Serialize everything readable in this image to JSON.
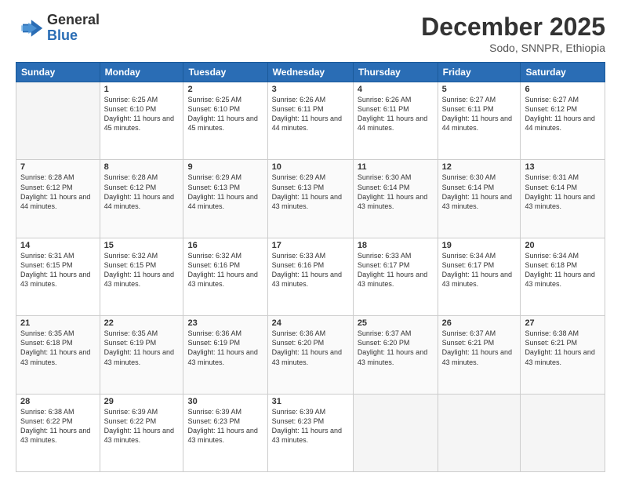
{
  "logo": {
    "general": "General",
    "blue": "Blue"
  },
  "header": {
    "title": "December 2025",
    "subtitle": "Sodo, SNNPR, Ethiopia"
  },
  "days_of_week": [
    "Sunday",
    "Monday",
    "Tuesday",
    "Wednesday",
    "Thursday",
    "Friday",
    "Saturday"
  ],
  "weeks": [
    [
      {
        "day": "",
        "empty": true
      },
      {
        "day": "1",
        "sunrise": "6:25 AM",
        "sunset": "6:10 PM",
        "daylight": "11 hours and 45 minutes."
      },
      {
        "day": "2",
        "sunrise": "6:25 AM",
        "sunset": "6:10 PM",
        "daylight": "11 hours and 45 minutes."
      },
      {
        "day": "3",
        "sunrise": "6:26 AM",
        "sunset": "6:11 PM",
        "daylight": "11 hours and 44 minutes."
      },
      {
        "day": "4",
        "sunrise": "6:26 AM",
        "sunset": "6:11 PM",
        "daylight": "11 hours and 44 minutes."
      },
      {
        "day": "5",
        "sunrise": "6:27 AM",
        "sunset": "6:11 PM",
        "daylight": "11 hours and 44 minutes."
      },
      {
        "day": "6",
        "sunrise": "6:27 AM",
        "sunset": "6:12 PM",
        "daylight": "11 hours and 44 minutes."
      }
    ],
    [
      {
        "day": "7",
        "sunrise": "6:28 AM",
        "sunset": "6:12 PM",
        "daylight": "11 hours and 44 minutes."
      },
      {
        "day": "8",
        "sunrise": "6:28 AM",
        "sunset": "6:12 PM",
        "daylight": "11 hours and 44 minutes."
      },
      {
        "day": "9",
        "sunrise": "6:29 AM",
        "sunset": "6:13 PM",
        "daylight": "11 hours and 44 minutes."
      },
      {
        "day": "10",
        "sunrise": "6:29 AM",
        "sunset": "6:13 PM",
        "daylight": "11 hours and 43 minutes."
      },
      {
        "day": "11",
        "sunrise": "6:30 AM",
        "sunset": "6:14 PM",
        "daylight": "11 hours and 43 minutes."
      },
      {
        "day": "12",
        "sunrise": "6:30 AM",
        "sunset": "6:14 PM",
        "daylight": "11 hours and 43 minutes."
      },
      {
        "day": "13",
        "sunrise": "6:31 AM",
        "sunset": "6:14 PM",
        "daylight": "11 hours and 43 minutes."
      }
    ],
    [
      {
        "day": "14",
        "sunrise": "6:31 AM",
        "sunset": "6:15 PM",
        "daylight": "11 hours and 43 minutes."
      },
      {
        "day": "15",
        "sunrise": "6:32 AM",
        "sunset": "6:15 PM",
        "daylight": "11 hours and 43 minutes."
      },
      {
        "day": "16",
        "sunrise": "6:32 AM",
        "sunset": "6:16 PM",
        "daylight": "11 hours and 43 minutes."
      },
      {
        "day": "17",
        "sunrise": "6:33 AM",
        "sunset": "6:16 PM",
        "daylight": "11 hours and 43 minutes."
      },
      {
        "day": "18",
        "sunrise": "6:33 AM",
        "sunset": "6:17 PM",
        "daylight": "11 hours and 43 minutes."
      },
      {
        "day": "19",
        "sunrise": "6:34 AM",
        "sunset": "6:17 PM",
        "daylight": "11 hours and 43 minutes."
      },
      {
        "day": "20",
        "sunrise": "6:34 AM",
        "sunset": "6:18 PM",
        "daylight": "11 hours and 43 minutes."
      }
    ],
    [
      {
        "day": "21",
        "sunrise": "6:35 AM",
        "sunset": "6:18 PM",
        "daylight": "11 hours and 43 minutes."
      },
      {
        "day": "22",
        "sunrise": "6:35 AM",
        "sunset": "6:19 PM",
        "daylight": "11 hours and 43 minutes."
      },
      {
        "day": "23",
        "sunrise": "6:36 AM",
        "sunset": "6:19 PM",
        "daylight": "11 hours and 43 minutes."
      },
      {
        "day": "24",
        "sunrise": "6:36 AM",
        "sunset": "6:20 PM",
        "daylight": "11 hours and 43 minutes."
      },
      {
        "day": "25",
        "sunrise": "6:37 AM",
        "sunset": "6:20 PM",
        "daylight": "11 hours and 43 minutes."
      },
      {
        "day": "26",
        "sunrise": "6:37 AM",
        "sunset": "6:21 PM",
        "daylight": "11 hours and 43 minutes."
      },
      {
        "day": "27",
        "sunrise": "6:38 AM",
        "sunset": "6:21 PM",
        "daylight": "11 hours and 43 minutes."
      }
    ],
    [
      {
        "day": "28",
        "sunrise": "6:38 AM",
        "sunset": "6:22 PM",
        "daylight": "11 hours and 43 minutes."
      },
      {
        "day": "29",
        "sunrise": "6:39 AM",
        "sunset": "6:22 PM",
        "daylight": "11 hours and 43 minutes."
      },
      {
        "day": "30",
        "sunrise": "6:39 AM",
        "sunset": "6:23 PM",
        "daylight": "11 hours and 43 minutes."
      },
      {
        "day": "31",
        "sunrise": "6:39 AM",
        "sunset": "6:23 PM",
        "daylight": "11 hours and 43 minutes."
      },
      {
        "day": "",
        "empty": true
      },
      {
        "day": "",
        "empty": true
      },
      {
        "day": "",
        "empty": true
      }
    ]
  ]
}
